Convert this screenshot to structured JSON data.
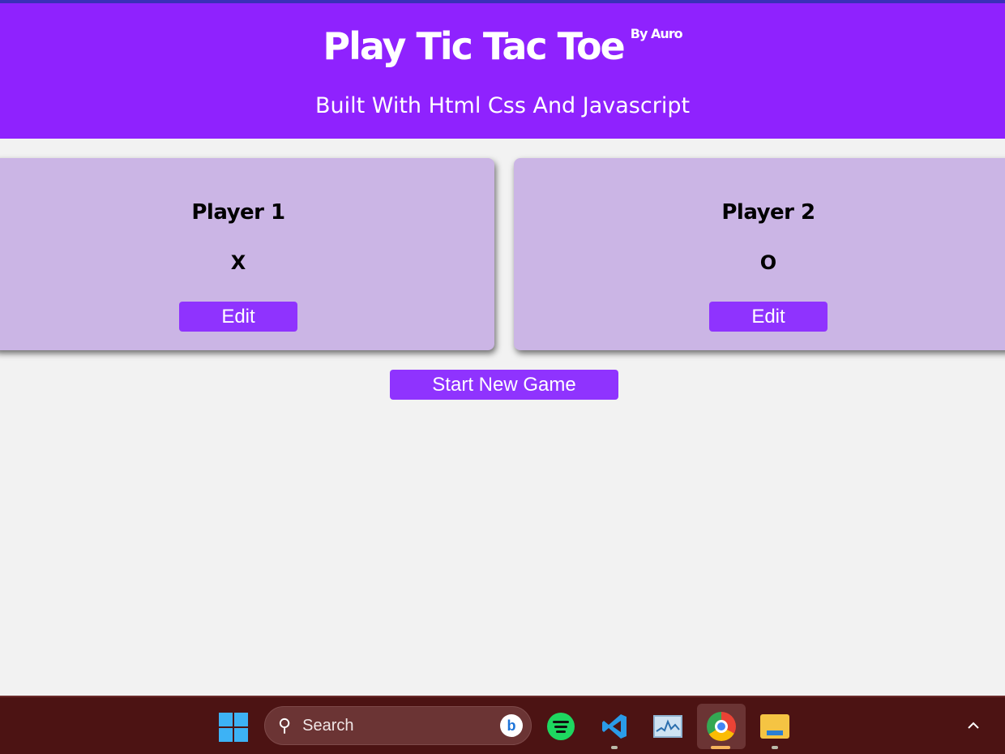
{
  "header": {
    "title": "Play Tic Tac Toe",
    "by": "By Auro",
    "subtitle": "Built With Html Css And Javascript"
  },
  "players": [
    {
      "name": "Player 1",
      "symbol": "X",
      "edit_label": "Edit"
    },
    {
      "name": "Player 2",
      "symbol": "O",
      "edit_label": "Edit"
    }
  ],
  "start_label": "Start New Game",
  "taskbar": {
    "search_placeholder": "Search",
    "icons": [
      "start-icon",
      "search-icon",
      "bing-icon",
      "spotify-icon",
      "vscode-icon",
      "performance-monitor-icon",
      "chrome-icon",
      "file-explorer-icon",
      "chevron-up-icon"
    ]
  },
  "colors": {
    "header_bg": "#8f22fe",
    "card_bg": "#cbb5e5",
    "button_bg": "#8f33fe",
    "taskbar_bg": "#4c1313"
  }
}
